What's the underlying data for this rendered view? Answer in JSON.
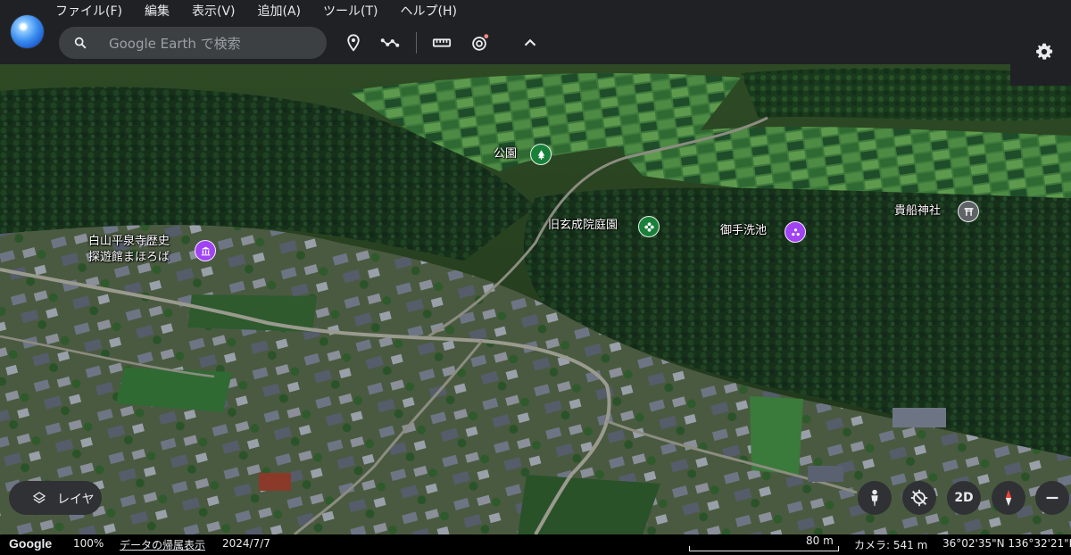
{
  "menu": [
    "ファイル(F)",
    "編集",
    "表示(V)",
    "追加(A)",
    "ツール(T)",
    "ヘルプ(H)"
  ],
  "search": {
    "placeholder": "Google Earth で検索"
  },
  "toolbar_icons": [
    "placemark-icon",
    "path-icon",
    "ruler-icon",
    "tour-icon",
    "collapse-icon",
    "settings-icon"
  ],
  "map_labels": {
    "park": "公園",
    "garden": "旧玄成院庭園",
    "pond": "御手洗池",
    "shrine": "貴船神社",
    "museum_line1": "白山平泉寺歴史",
    "museum_line2": "探遊館まほろば"
  },
  "pin_colors": {
    "park": "#188038",
    "garden": "#188038",
    "pond": "#a142f4",
    "shrine": "#5f6368",
    "museum": "#a142f4"
  },
  "controls": {
    "layers_label": "レイヤ",
    "view_mode": "2D"
  },
  "status": {
    "brand": "Google",
    "zoom": "100%",
    "attribution": "データの帰属表示",
    "imagery_date": "2024/7/7",
    "scale": "80 m",
    "camera": "カメラ: 541 m",
    "coordinates": "36°02'35\"N 136°32'21\"E"
  }
}
